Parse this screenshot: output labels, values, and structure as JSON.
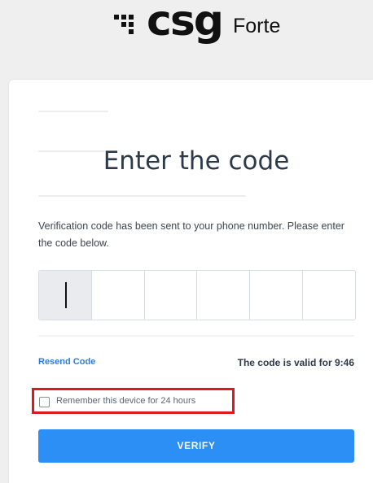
{
  "brand": {
    "logo_text": "csg",
    "logo_sub": "Forte"
  },
  "page": {
    "title": "Enter the code",
    "description": "Verification code has been sent to your phone number. Please enter the code below."
  },
  "code": {
    "boxes": [
      "",
      "",
      "",
      "",
      "",
      ""
    ]
  },
  "resend_label": "Resend Code",
  "validity_text": "The code is valid for 9:46",
  "remember": {
    "label": "Remember this device for 24 hours",
    "checked": false
  },
  "verify_label": "VERIFY",
  "colors": {
    "accent": "#2b8ff6",
    "link": "#2a7de1",
    "highlight": "#e2161f"
  }
}
